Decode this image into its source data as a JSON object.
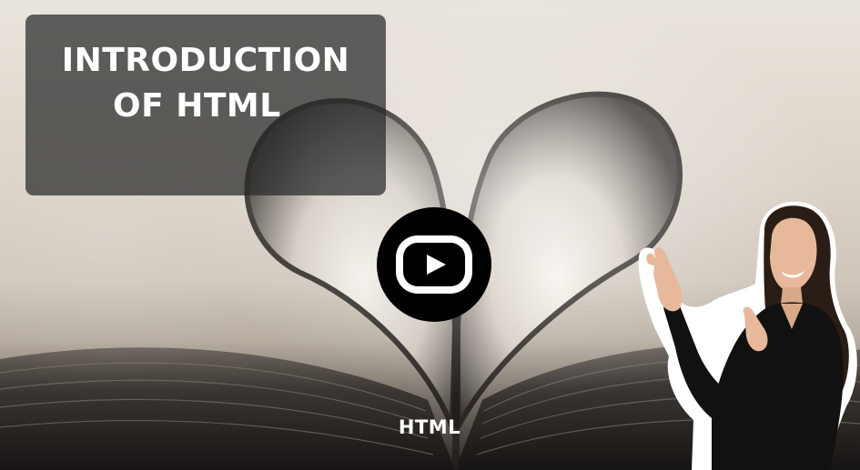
{
  "title": {
    "line1": "INTRODUCTION",
    "line2": "OF HTML"
  },
  "caption": "HTML",
  "icons": {
    "play": "play-button-icon",
    "presenter": "presenter-illustration"
  },
  "colors": {
    "title_card_bg": "#282828",
    "title_text": "#ffffff",
    "play_button": "#000000"
  }
}
